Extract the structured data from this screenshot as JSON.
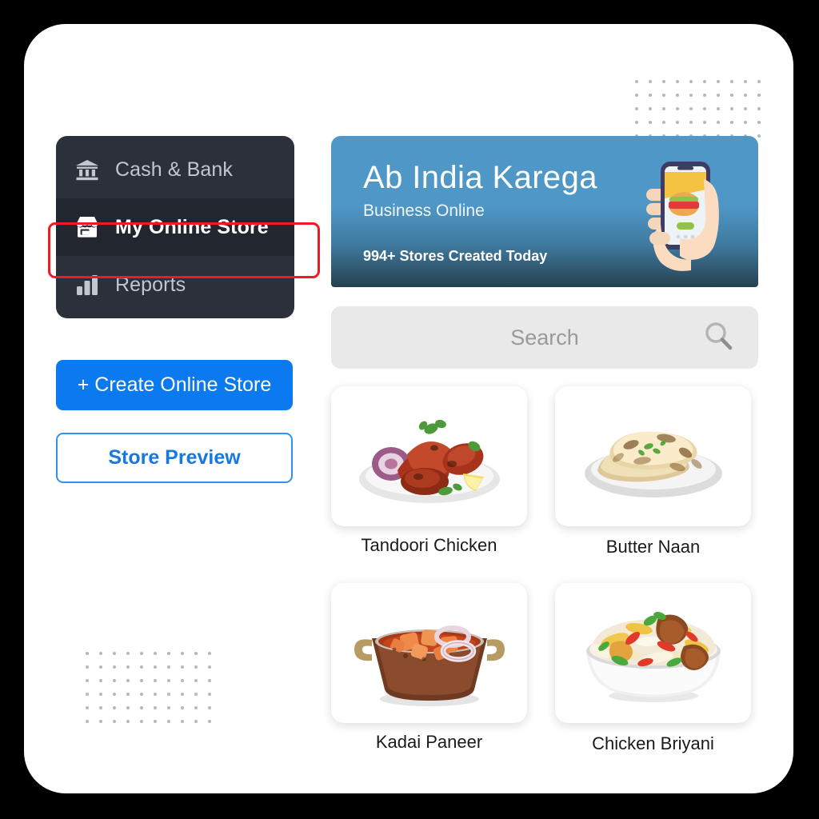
{
  "app": {
    "background_color": "#000000",
    "panel_color": "#ffffff"
  },
  "sidebar": {
    "background_color": "#2b303a",
    "active_highlight_color": "#ee1b24",
    "items": [
      {
        "label": "Cash & Bank",
        "icon": "bank-icon",
        "active": false
      },
      {
        "label": "My Online Store",
        "icon": "store-icon",
        "active": true
      },
      {
        "label": "Reports",
        "icon": "bar-chart-icon",
        "active": false
      }
    ],
    "buttons": {
      "create_store_label": "+ Create Online Store",
      "store_preview_label": "Store Preview",
      "primary_color": "#0b79ef",
      "outline_color": "#3291ef"
    }
  },
  "banner": {
    "title": "Ab India Karega",
    "subtitle": "Business Online",
    "stat": "994+ Stores Created Today",
    "illustration": "hand-holding-phone-with-burger-icon",
    "gradient_top": "#4f97c7",
    "gradient_bottom": "#26414f"
  },
  "search": {
    "placeholder": "Search",
    "value": "",
    "icon": "search-icon",
    "background_color": "#e9e9ea"
  },
  "products": [
    {
      "name": "Tandoori Chicken",
      "image": "tandoori-chicken-photo"
    },
    {
      "name": "Butter Naan",
      "image": "butter-naan-photo"
    },
    {
      "name": "Kadai Paneer",
      "image": "kadai-paneer-photo"
    },
    {
      "name": "Chicken Briyani",
      "image": "chicken-briyani-photo"
    }
  ],
  "decorations": {
    "dot_grid_top_right": {
      "columns": 10,
      "rows": 5,
      "color": "#b8b8b8"
    },
    "dot_grid_bottom_left": {
      "columns": 10,
      "rows": 6,
      "color": "#b8b8b8"
    }
  }
}
